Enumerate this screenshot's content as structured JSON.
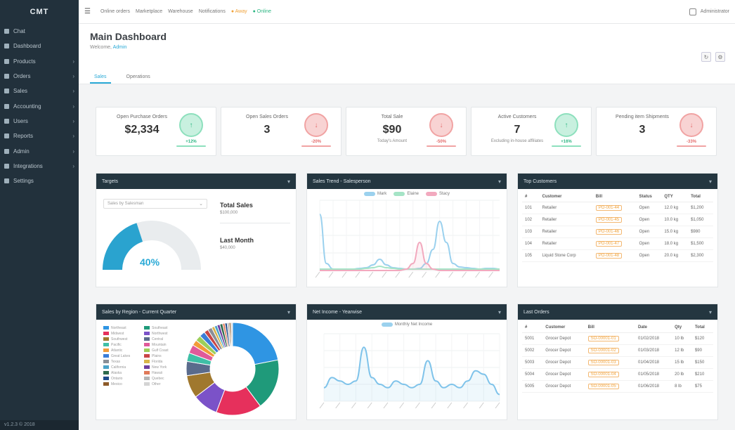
{
  "sidebar": {
    "logo": "CMT",
    "items": [
      {
        "label": "Chat",
        "has_children": false
      },
      {
        "label": "Dashboard",
        "has_children": false
      },
      {
        "label": "Products",
        "has_children": true
      },
      {
        "label": "Orders",
        "has_children": true
      },
      {
        "label": "Sales",
        "has_children": true
      },
      {
        "label": "Accounting",
        "has_children": true
      },
      {
        "label": "Users",
        "has_children": true
      },
      {
        "label": "Reports",
        "has_children": true
      },
      {
        "label": "Admin",
        "has_children": true
      },
      {
        "label": "Integrations",
        "has_children": true
      },
      {
        "label": "Settings",
        "has_children": false
      }
    ],
    "footer": "v1.2.3 © 2018"
  },
  "topbar": {
    "crumbs": [
      {
        "label": "Online orders",
        "tone": "normal"
      },
      {
        "label": "Marketplace",
        "tone": "normal"
      },
      {
        "label": "Warehouse",
        "tone": "normal"
      },
      {
        "label": "Notifications",
        "tone": "normal"
      },
      {
        "label": "● Away",
        "tone": "orange"
      },
      {
        "label": "● Online",
        "tone": "green"
      }
    ],
    "user_name": "Administrator"
  },
  "header": {
    "title": "Main Dashboard",
    "sub_prefix": "Welcome,",
    "sub_accent": "Admin",
    "tabs": [
      {
        "label": "Sales",
        "active": true
      },
      {
        "label": "Operations",
        "active": false
      }
    ]
  },
  "kpis": [
    {
      "title": "Open Purchase Orders",
      "value": "$2,334",
      "sub": "",
      "badge": "↑",
      "trend": "up",
      "pct": "+12%"
    },
    {
      "title": "Open Sales Orders",
      "value": "3",
      "sub": "",
      "badge": "↓",
      "trend": "down",
      "pct": "-20%"
    },
    {
      "title": "Total Sale",
      "value": "$90",
      "sub": "Today's Amount",
      "badge": "↓",
      "trend": "down",
      "pct": "-50%"
    },
    {
      "title": "Active Customers",
      "value": "7",
      "sub": "Excluding in-house affiliates",
      "badge": "↑",
      "trend": "up",
      "pct": "+16%"
    },
    {
      "title": "Pending item Shipments",
      "value": "3",
      "sub": "",
      "badge": "↓",
      "trend": "down",
      "pct": "-33%"
    }
  ],
  "panels": {
    "targets": {
      "title": "Targets",
      "select": "Sales by Salesman",
      "gauge_value": 40,
      "gauge_pct": "40%",
      "total_label": "Total Sales",
      "total_sub": "$100,000",
      "last_label": "Last Month",
      "last_sub": "$40,000"
    },
    "sales_trend": {
      "title": "Sales Trend - Salesperson",
      "legend": [
        "Mark",
        "Elaine",
        "Stacy"
      ]
    },
    "top_customers": {
      "title": "Top Customers",
      "headers": [
        "#",
        "Customer",
        "Bill",
        "Status",
        "QTY",
        "Total"
      ],
      "rows": [
        [
          "101",
          "Retailer",
          "PO-001-44",
          "Open",
          "12.0 kg",
          "$1,200"
        ],
        [
          "102",
          "Retailer",
          "PO-001-45",
          "Open",
          "10.0 kg",
          "$1,050"
        ],
        [
          "103",
          "Retailer",
          "PO-001-46",
          "Open",
          "15.0 kg",
          "$980"
        ],
        [
          "104",
          "Retailer",
          "PO-001-47",
          "Open",
          "18.0 kg",
          "$1,500"
        ],
        [
          "105",
          "Liquid Stone Corp",
          "PO-001-48",
          "Open",
          "20.0 kg",
          "$2,300"
        ]
      ]
    },
    "sales_by_region": {
      "title": "Sales by Region - Current Quarter",
      "legend": [
        "Northeast",
        "Southeast",
        "Midwest",
        "Northwest",
        "Southwest",
        "Central",
        "Pacific",
        "Mountain",
        "Atlantic",
        "Gulf Coast",
        "Great Lakes",
        "Plains",
        "Texas",
        "Florida",
        "California",
        "New York",
        "Alaska",
        "Hawaii",
        "Ontario",
        "Quebec",
        "Mexico",
        "Other"
      ],
      "colors": [
        "#2f95e3",
        "#1f9a7a",
        "#e6305c",
        "#7b52c8",
        "#a0782e",
        "#5a6b8c",
        "#3fbfa6",
        "#e05a9a",
        "#f29b38",
        "#9ccf5a",
        "#3b7dd8",
        "#c94646",
        "#8a8f97",
        "#d8b64a",
        "#4aa3c9",
        "#6e3f9f",
        "#2e6b4d",
        "#e07a5a",
        "#1d4a8a",
        "#b5b5b5",
        "#8d5b2a",
        "#d4d4d4"
      ],
      "values": [
        22,
        18,
        16,
        9,
        8,
        5,
        3,
        3,
        2,
        2,
        2,
        1.5,
        1.5,
        1,
        1,
        1,
        1,
        0.8,
        0.8,
        0.7,
        0.6,
        0.6
      ]
    },
    "net_income": {
      "title": "Net Income - Yearwise",
      "legend": "Monthly Net Income"
    },
    "last_orders": {
      "title": "Last Orders",
      "headers": [
        "#",
        "Customer",
        "Bill",
        "Date",
        "Qty",
        "Total"
      ],
      "rows": [
        [
          "5001",
          "Grocer Depot",
          "SO-00001-01",
          "01/02/2018",
          "10 lb",
          "$120"
        ],
        [
          "5002",
          "Grocer Depot",
          "SO-00001-02",
          "01/03/2018",
          "12 lb",
          "$90"
        ],
        [
          "5003",
          "Grocer Depot",
          "SO-00001-03",
          "01/04/2018",
          "15 lb",
          "$150"
        ],
        [
          "5004",
          "Grocer Depot",
          "SO-00001-04",
          "01/05/2018",
          "20 lb",
          "$210"
        ],
        [
          "5005",
          "Grocer Depot",
          "SO-00001-05",
          "01/06/2018",
          "8 lb",
          "$75"
        ]
      ]
    }
  },
  "chart_data": [
    {
      "type": "line",
      "title": "Sales Trend - Salesperson",
      "x": [
        1,
        2,
        3,
        4,
        5,
        6,
        7,
        8,
        9,
        10,
        11,
        12,
        13,
        14,
        15,
        16,
        17,
        18,
        19,
        20,
        21,
        22,
        23,
        24,
        25,
        26,
        27,
        28
      ],
      "series": [
        {
          "name": "Mark",
          "color": "#9bd1ee",
          "values": [
            80,
            10,
            2,
            2,
            2,
            2,
            3,
            4,
            8,
            16,
            8,
            4,
            3,
            2,
            2,
            3,
            10,
            30,
            70,
            40,
            10,
            5,
            4,
            3,
            2,
            3,
            3,
            2
          ]
        },
        {
          "name": "Elaine",
          "color": "#a5e4c6",
          "values": [
            2,
            2,
            2,
            2,
            2,
            2,
            2,
            3,
            4,
            6,
            4,
            3,
            2,
            2,
            2,
            2,
            2,
            2,
            2,
            2,
            2,
            2,
            2,
            2,
            2,
            2,
            2,
            2
          ]
        },
        {
          "name": "Stacy",
          "color": "#f2a9be",
          "values": [
            0,
            0,
            0,
            0,
            0,
            0,
            0,
            0,
            0,
            0,
            0,
            0,
            0,
            2,
            10,
            40,
            10,
            2,
            0,
            0,
            0,
            0,
            0,
            0,
            0,
            0,
            0,
            0
          ]
        }
      ],
      "ylim": [
        0,
        100
      ],
      "grid": true,
      "legend_position": "top"
    },
    {
      "type": "pie",
      "title": "Sales by Region - Current Quarter",
      "categories": [
        "Northeast",
        "Southeast",
        "Midwest",
        "Northwest",
        "Southwest",
        "Central",
        "Pacific",
        "Mountain",
        "Atlantic",
        "Gulf Coast",
        "Great Lakes",
        "Plains",
        "Texas",
        "Florida",
        "California",
        "New York",
        "Alaska",
        "Hawaii",
        "Ontario",
        "Quebec",
        "Mexico",
        "Other"
      ],
      "values": [
        22,
        18,
        16,
        9,
        8,
        5,
        3,
        3,
        2,
        2,
        2,
        1.5,
        1.5,
        1,
        1,
        1,
        1,
        0.8,
        0.8,
        0.7,
        0.6,
        0.6
      ],
      "legend_position": "left"
    },
    {
      "type": "area",
      "title": "Net Income - Yearwise",
      "x": [
        1,
        2,
        3,
        4,
        5,
        6,
        7,
        8,
        9,
        10,
        11,
        12,
        13,
        14,
        15,
        16,
        17,
        18,
        19,
        20,
        21,
        22,
        23
      ],
      "series": [
        {
          "name": "Monthly Net Income",
          "color": "#7fc3ea",
          "values": [
            20,
            35,
            30,
            25,
            30,
            80,
            35,
            25,
            20,
            30,
            25,
            20,
            25,
            60,
            30,
            20,
            25,
            20,
            30,
            45,
            40,
            25,
            10
          ]
        }
      ],
      "ylim": [
        0,
        100
      ],
      "grid": true,
      "legend_position": "top"
    }
  ]
}
